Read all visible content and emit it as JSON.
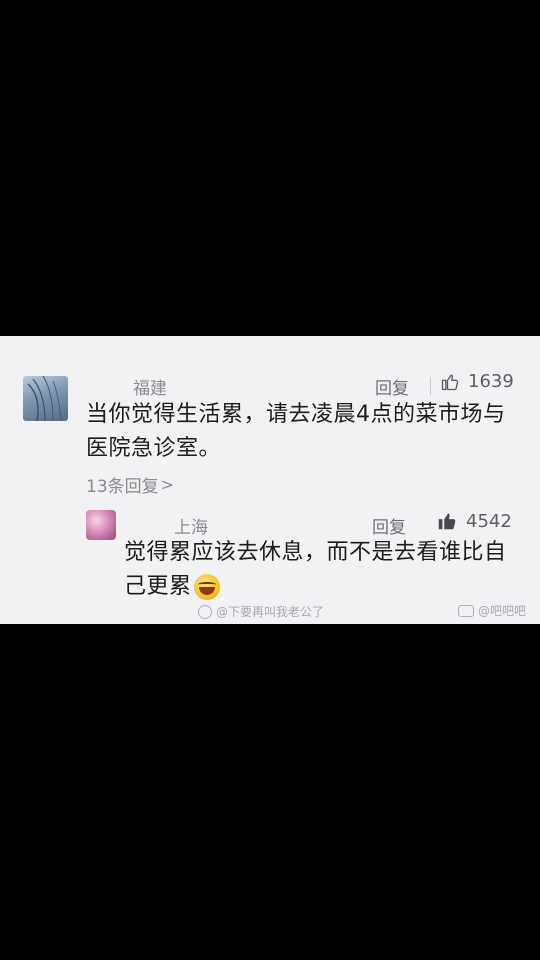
{
  "comment": {
    "location": "福建",
    "reply_label": "回复",
    "like_count": "1639",
    "text": "当你觉得生活累，请去凌晨4点的菜市场与医院急诊室。",
    "more_replies": "13条回复",
    "more_replies_chevron": ">"
  },
  "reply": {
    "location": "上海",
    "reply_label": "回复",
    "like_count": "4542",
    "text": "觉得累应该去休息，而不是去看谁比自己更累"
  },
  "watermarks": {
    "left": "@下要再叫我老公了",
    "right": "@吧吧吧"
  },
  "colors": {
    "background": "#000000",
    "card": "#f2f2f4",
    "text": "#1c1c1e",
    "muted": "#8a8a8e"
  }
}
